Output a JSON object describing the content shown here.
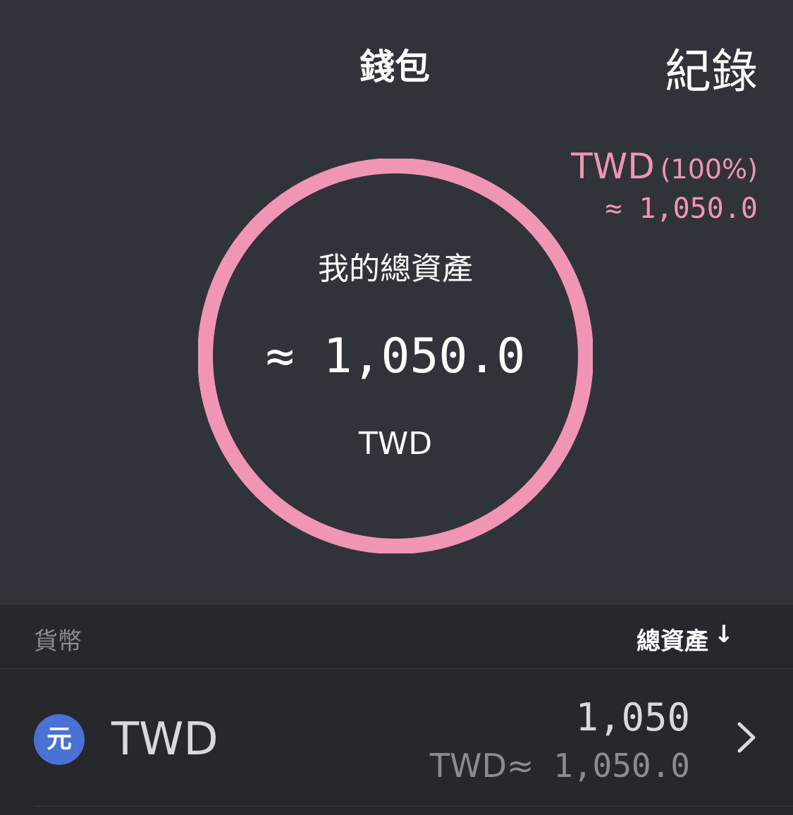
{
  "tabs": {
    "wallet": "錢包",
    "history": "紀錄"
  },
  "legend": {
    "currency": "TWD",
    "percent": "(100%)",
    "approx_value": "≈ 1,050.0",
    "color": "#f095b3"
  },
  "donut": {
    "label": "我的總資產",
    "value": "≈ 1,050.0",
    "currency": "TWD",
    "share_fraction": 1.0,
    "ring_color": "#f095b3"
  },
  "table_header": {
    "currency_col": "貨幣",
    "total_col": "總資產",
    "sort_arrow": "↓"
  },
  "assets": [
    {
      "icon_glyph": "元",
      "icon_color": "#4a72d4",
      "code": "TWD",
      "amount": "1,050",
      "equiv_prefix": "TWD≈",
      "equiv_value": " 1,050.0"
    }
  ]
}
